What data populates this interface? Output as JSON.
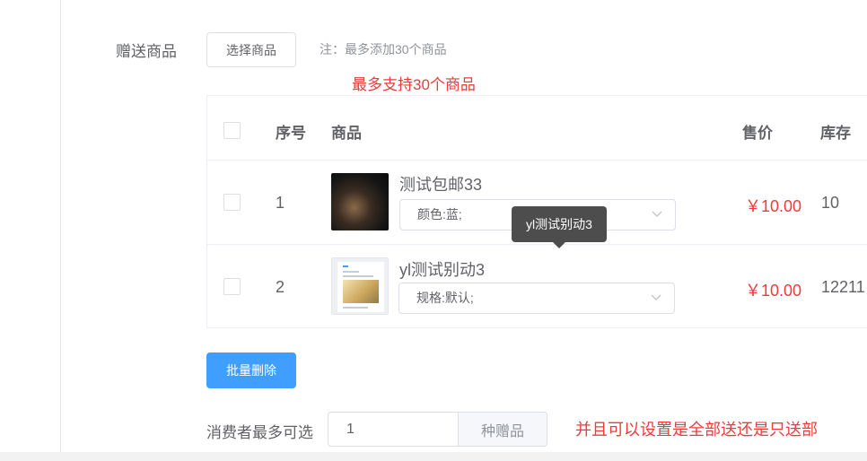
{
  "form": {
    "cut_text": "",
    "gift_label": "赠送商品",
    "select_button": "选择商品",
    "note": "注：最多添加30个商品",
    "annotation_top": "最多支持30个商品"
  },
  "table": {
    "headers": {
      "index": "序号",
      "goods": "商品",
      "price": "售价",
      "stock": "库存"
    },
    "rows": [
      {
        "index": "1",
        "name": "测试包邮33",
        "sku": "颜色:蓝;",
        "price": "￥10.00",
        "stock": "10"
      },
      {
        "index": "2",
        "name": "yl测试别动3",
        "sku": "规格:默认;",
        "price": "￥10.00",
        "stock": "12211"
      }
    ]
  },
  "tooltip": {
    "text": "yl测试别动3"
  },
  "actions": {
    "batch_delete": "批量删除"
  },
  "consumer": {
    "label": "消费者最多可选",
    "value": "1",
    "append": "种赠品",
    "annotation": "并且可以设置是全部送还是只送部"
  },
  "colors": {
    "primary": "#409eff",
    "danger": "#f03a3a",
    "border": "#dcdfe6"
  }
}
